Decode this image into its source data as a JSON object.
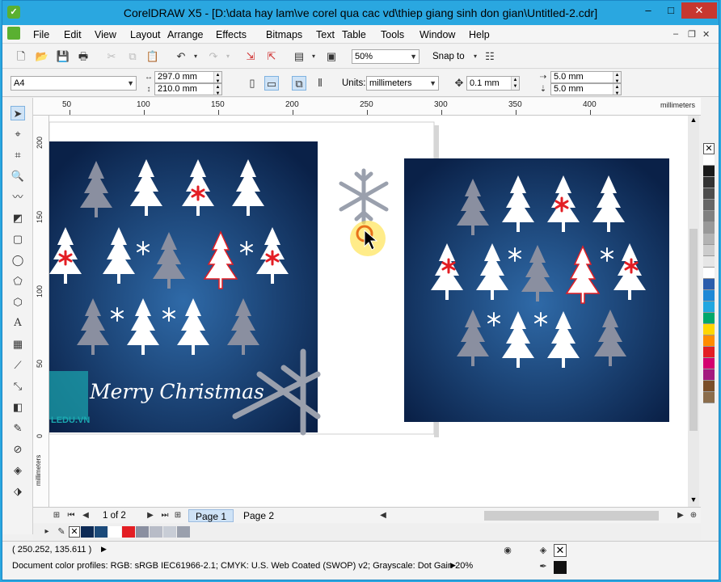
{
  "window": {
    "title": "CorelDRAW X5 - [D:\\data hay lam\\ve corel qua cac vd\\thiep giang sinh don gian\\Untitled-2.cdr]",
    "app_icon": "coreldraw-icon",
    "min": "–",
    "max": "□",
    "close": "✕"
  },
  "menu": [
    "File",
    "Edit",
    "View",
    "Layout",
    "Arrange",
    "Effects",
    "Bitmaps",
    "Text",
    "Table",
    "Tools",
    "Window",
    "Help"
  ],
  "toolbar": {
    "zoom": "50%",
    "snap_to": "Snap to"
  },
  "property_bar": {
    "page_size": "A4",
    "width": "297.0 mm",
    "height": "210.0 mm",
    "units_label": "Units:",
    "units_value": "millimeters",
    "nudge": "0.1 mm",
    "dup_x": "5.0 mm",
    "dup_y": "5.0 mm"
  },
  "ruler": {
    "h_ticks": [
      "50",
      "100",
      "150",
      "200",
      "250",
      "300",
      "350",
      "400"
    ],
    "h_unit": "millimeters",
    "v_ticks": [
      "200",
      "150",
      "100",
      "50",
      "0"
    ],
    "v_unit": "millimeters"
  },
  "artwork": {
    "greeting": "Merry Christmas",
    "logo_text": "LEDU.VN",
    "bg_color": "#0d2a55"
  },
  "navigator": {
    "page_count": "1 of 2",
    "tabs": [
      "Page 1",
      "Page 2"
    ]
  },
  "status": {
    "coords": "( 250.252, 135.611 )",
    "profiles": "Document color profiles: RGB: sRGB IEC61966-2.1; CMYK: U.S. Web Coated (SWOP) v2; Grayscale: Dot Gain 20%"
  },
  "palette_colors": [
    "#ffffff",
    "#1a1a1a",
    "#333333",
    "#4d4d4d",
    "#666666",
    "#808080",
    "#999999",
    "#b3b3b3",
    "#cccccc",
    "#e6e6e6",
    "#ffffff",
    "#2b5cab",
    "#1e88d6",
    "#22a7e0",
    "#00a86b",
    "#ffd600",
    "#ff8c00",
    "#e31e24",
    "#d4006f",
    "#a31a7e",
    "#7b4f2a",
    "#8b6d4c"
  ],
  "doc_palette_colors": [
    "#0d2a55",
    "#1b4a7a",
    "#ffffff",
    "#e31e24",
    "#8a8fa0",
    "#b8bcc7",
    "#c8cdd6",
    "#9aa0ad"
  ]
}
